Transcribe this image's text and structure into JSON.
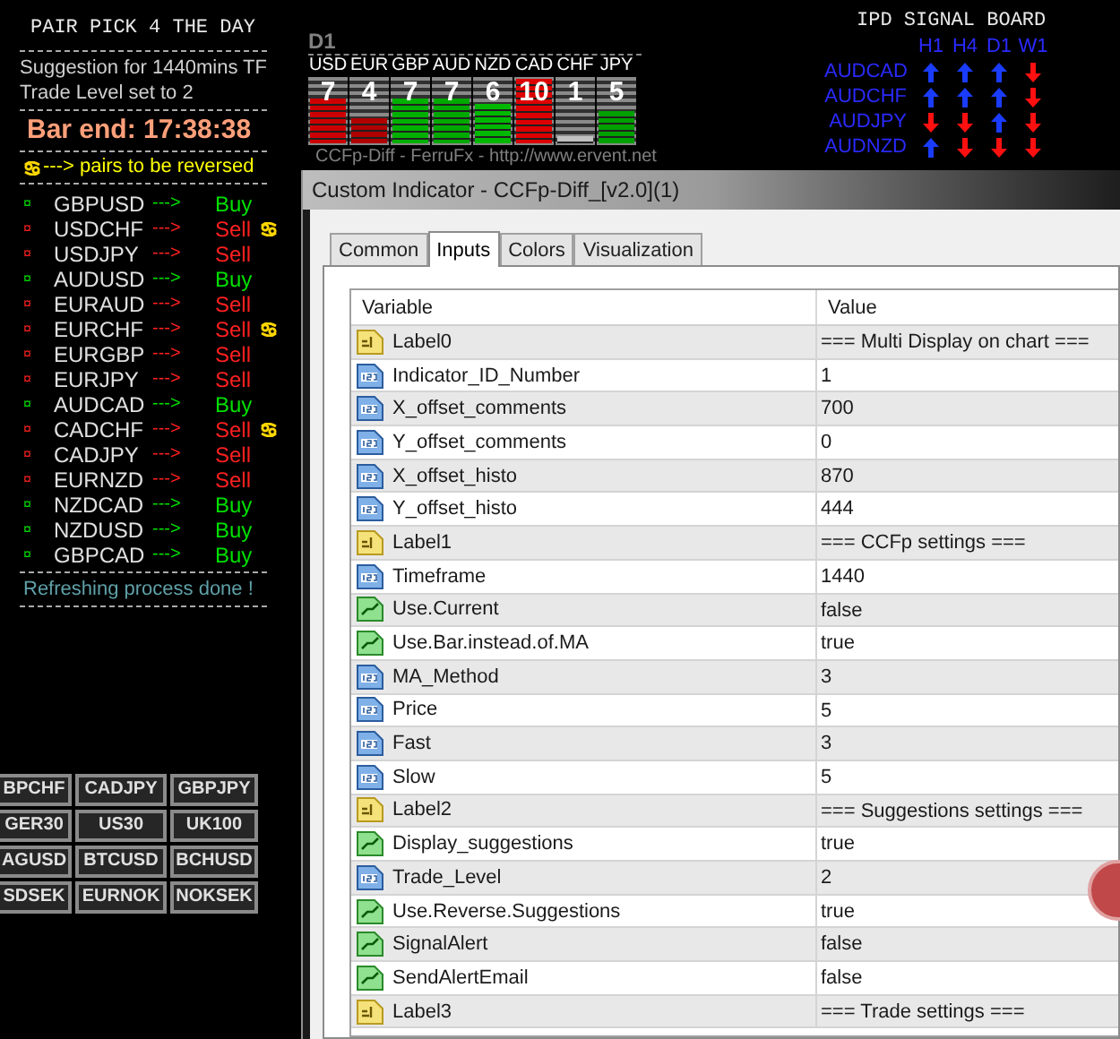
{
  "left_panel": {
    "title": "PAIR PICK 4 THE DAY",
    "suggestion": "Suggestion for 1440mins TF",
    "trade_level": "Trade Level set to 2",
    "bar_end": "Bar end: 17:38:38",
    "legend": "---> pairs to be reversed",
    "pairs": [
      {
        "marker": "¤",
        "pair": "GBPUSD",
        "arrow": "--->",
        "signal": "Buy",
        "kind": "buy",
        "reversed": false
      },
      {
        "marker": "¤",
        "pair": "USDCHF",
        "arrow": "--->",
        "signal": "Sell",
        "kind": "sell",
        "reversed": true
      },
      {
        "marker": "¤",
        "pair": "USDJPY",
        "arrow": "--->",
        "signal": "Sell",
        "kind": "sell",
        "reversed": false
      },
      {
        "marker": "¤",
        "pair": "AUDUSD",
        "arrow": "--->",
        "signal": "Buy",
        "kind": "buy",
        "reversed": false
      },
      {
        "marker": "¤",
        "pair": "EURAUD",
        "arrow": "--->",
        "signal": "Sell",
        "kind": "sell",
        "reversed": false
      },
      {
        "marker": "¤",
        "pair": "EURCHF",
        "arrow": "--->",
        "signal": "Sell",
        "kind": "sell",
        "reversed": true
      },
      {
        "marker": "¤",
        "pair": "EURGBP",
        "arrow": "--->",
        "signal": "Sell",
        "kind": "sell",
        "reversed": false
      },
      {
        "marker": "¤",
        "pair": "EURJPY",
        "arrow": "--->",
        "signal": "Sell",
        "kind": "sell",
        "reversed": false
      },
      {
        "marker": "¤",
        "pair": "AUDCAD",
        "arrow": "--->",
        "signal": "Buy",
        "kind": "buy",
        "reversed": false
      },
      {
        "marker": "¤",
        "pair": "CADCHF",
        "arrow": "--->",
        "signal": "Sell",
        "kind": "sell",
        "reversed": true
      },
      {
        "marker": "¤",
        "pair": "CADJPY",
        "arrow": "--->",
        "signal": "Sell",
        "kind": "sell",
        "reversed": false
      },
      {
        "marker": "¤",
        "pair": "EURNZD",
        "arrow": "--->",
        "signal": "Sell",
        "kind": "sell",
        "reversed": false
      },
      {
        "marker": "¤",
        "pair": "NZDCAD",
        "arrow": "--->",
        "signal": "Buy",
        "kind": "buy",
        "reversed": false
      },
      {
        "marker": "¤",
        "pair": "NZDUSD",
        "arrow": "--->",
        "signal": "Buy",
        "kind": "buy",
        "reversed": false
      },
      {
        "marker": "¤",
        "pair": "GBPCAD",
        "arrow": "--->",
        "signal": "Buy",
        "kind": "buy",
        "reversed": false
      }
    ],
    "status": "Refreshing process done !"
  },
  "meter": {
    "timeframe": "D1",
    "currencies": [
      {
        "code": "USD",
        "value": "7",
        "level": 0.7,
        "color": "#cc0000"
      },
      {
        "code": "EUR",
        "value": "4",
        "level": 0.4,
        "color": "#b00000"
      },
      {
        "code": "GBP",
        "value": "7",
        "level": 0.7,
        "color": "#00b000"
      },
      {
        "code": "AUD",
        "value": "7",
        "level": 0.7,
        "color": "#00a800"
      },
      {
        "code": "NZD",
        "value": "6",
        "level": 0.6,
        "color": "#00b800"
      },
      {
        "code": "CAD",
        "value": "10",
        "level": 1,
        "color": "#dd0000"
      },
      {
        "code": "CHF",
        "value": "1",
        "level": 0.1,
        "color": "#c0c0c0"
      },
      {
        "code": "JPY",
        "value": "5",
        "level": 0.5,
        "color": "#00a000"
      }
    ],
    "footer": "CCFp-Diff - FerruFx - http://www.ervent.net"
  },
  "signal_board": {
    "title": "IPD SIGNAL BOARD",
    "columns": [
      "H1",
      "H4",
      "D1",
      "W1"
    ],
    "rows": [
      {
        "pair": "AUDCAD",
        "signals": [
          {
            "kind": "up"
          },
          {
            "kind": "up"
          },
          {
            "kind": "up"
          },
          {
            "kind": "down"
          }
        ]
      },
      {
        "pair": "AUDCHF",
        "signals": [
          {
            "kind": "up"
          },
          {
            "kind": "up"
          },
          {
            "kind": "up"
          },
          {
            "kind": "down"
          }
        ]
      },
      {
        "pair": "AUDJPY",
        "signals": [
          {
            "kind": "down"
          },
          {
            "kind": "down"
          },
          {
            "kind": "up"
          },
          {
            "kind": "down"
          }
        ]
      },
      {
        "pair": "AUDNZD",
        "signals": [
          {
            "kind": "up"
          },
          {
            "kind": "down"
          },
          {
            "kind": "down"
          },
          {
            "kind": "down"
          }
        ]
      }
    ]
  },
  "pair_buttons": [
    "BPCHF",
    "CADJPY",
    "GBPJPY",
    "GER30",
    "US30",
    "UK100",
    "AGUSD",
    "BTCUSD",
    "BCHUSD",
    "SDSEK",
    "EURNOK",
    "NOKSEK"
  ],
  "dialog": {
    "title": "Custom Indicator - CCFp-Diff_[v2.0](1)",
    "tabs": [
      {
        "label": "Common",
        "selected": false
      },
      {
        "label": "Inputs",
        "selected": true
      },
      {
        "label": "Colors",
        "selected": false
      },
      {
        "label": "Visualization",
        "selected": false
      }
    ],
    "columns": [
      "Variable",
      "Value"
    ],
    "rows": [
      {
        "kind": "label",
        "variable": "Label0",
        "value": "=== Multi Display on chart ==="
      },
      {
        "kind": "number",
        "variable": "Indicator_ID_Number",
        "value": "1"
      },
      {
        "kind": "number",
        "variable": "X_offset_comments",
        "value": "700"
      },
      {
        "kind": "number",
        "variable": "Y_offset_comments",
        "value": "0"
      },
      {
        "kind": "number",
        "variable": "X_offset_histo",
        "value": "870"
      },
      {
        "kind": "number",
        "variable": "Y_offset_histo",
        "value": "444"
      },
      {
        "kind": "label",
        "variable": "Label1",
        "value": "=== CCFp settings ==="
      },
      {
        "kind": "number",
        "variable": "Timeframe",
        "value": "1440"
      },
      {
        "kind": "boolean",
        "variable": "Use.Current",
        "value": "false"
      },
      {
        "kind": "boolean",
        "variable": "Use.Bar.instead.of.MA",
        "value": "true"
      },
      {
        "kind": "number",
        "variable": "MA_Method",
        "value": "3"
      },
      {
        "kind": "number",
        "variable": "Price",
        "value": "5"
      },
      {
        "kind": "number",
        "variable": "Fast",
        "value": "3"
      },
      {
        "kind": "number",
        "variable": "Slow",
        "value": "5"
      },
      {
        "kind": "label",
        "variable": "Label2",
        "value": "=== Suggestions settings ==="
      },
      {
        "kind": "boolean",
        "variable": "Display_suggestions",
        "value": "true"
      },
      {
        "kind": "number",
        "variable": "Trade_Level",
        "value": "2"
      },
      {
        "kind": "boolean",
        "variable": "Use.Reverse.Suggestions",
        "value": "true"
      },
      {
        "kind": "boolean",
        "variable": "SignalAlert",
        "value": "false"
      },
      {
        "kind": "boolean",
        "variable": "SendAlertEmail",
        "value": "false"
      },
      {
        "kind": "label",
        "variable": "Label3",
        "value": "=== Trade settings ==="
      }
    ]
  }
}
